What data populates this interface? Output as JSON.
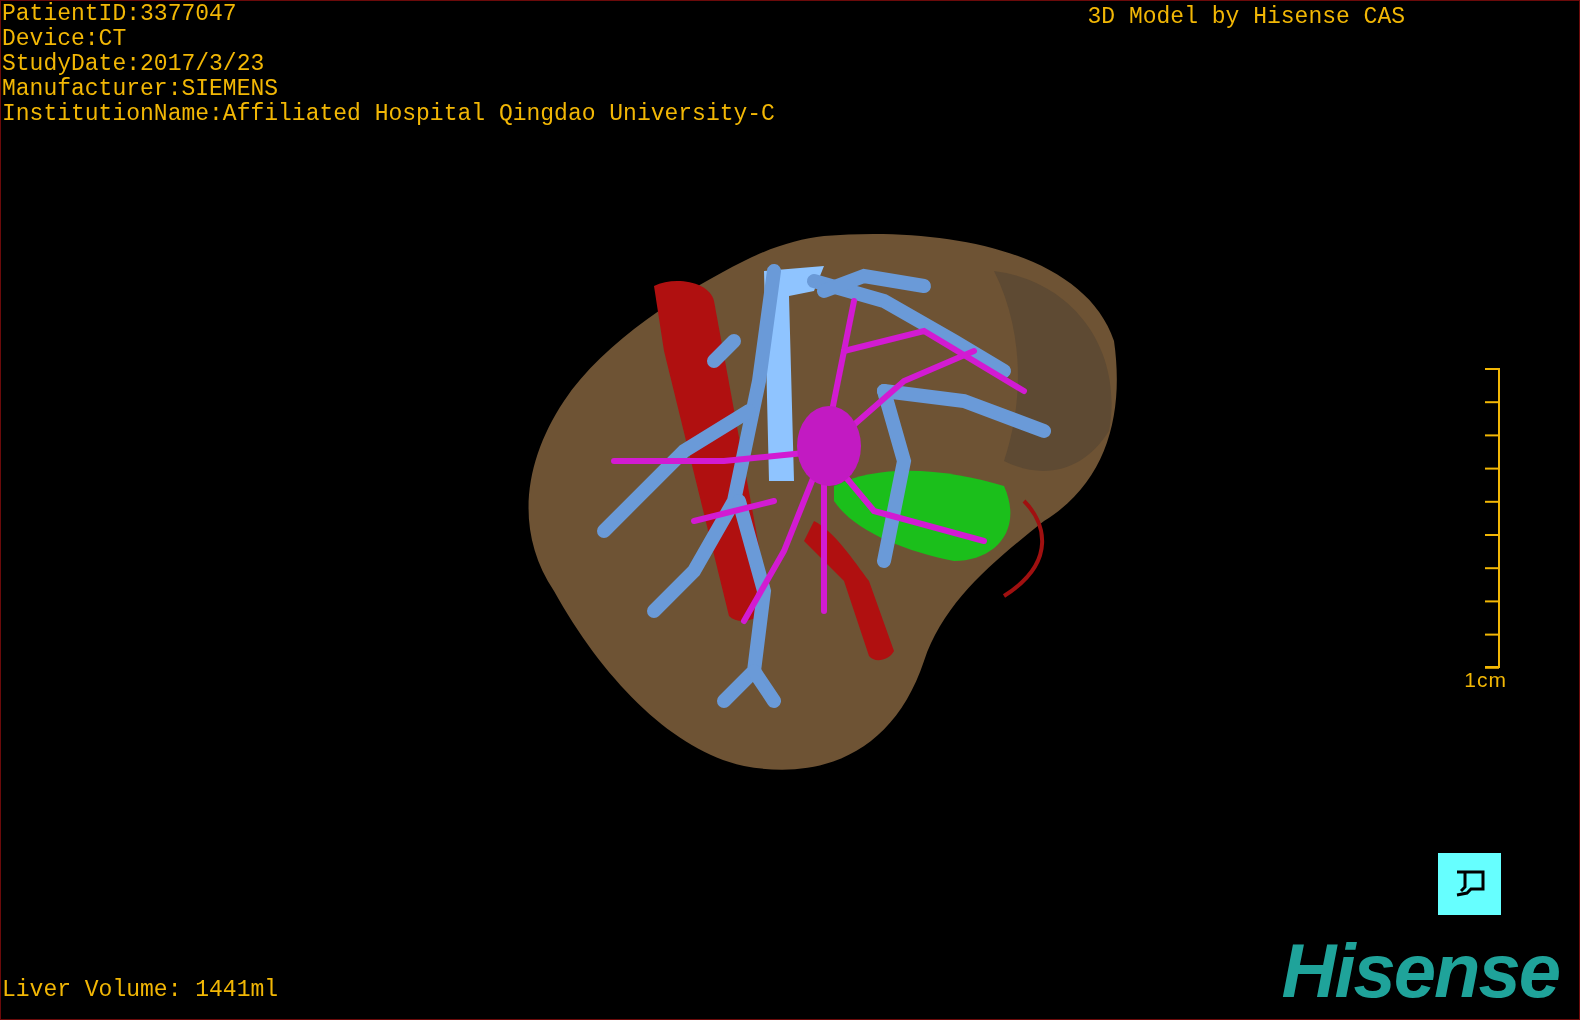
{
  "patient_info": [
    "PatientID:3377047",
    "Device:CT",
    "StudyDate:2017/3/23",
    "Manufacturer:SIEMENS",
    "InstitutionName:Affiliated Hospital Qingdao University-C"
  ],
  "title": "3D Model by Hisense CAS",
  "scale_bar": {
    "label": "1cm"
  },
  "liver_volume": "Liver Volume: 1441ml",
  "logo": "Hisense"
}
